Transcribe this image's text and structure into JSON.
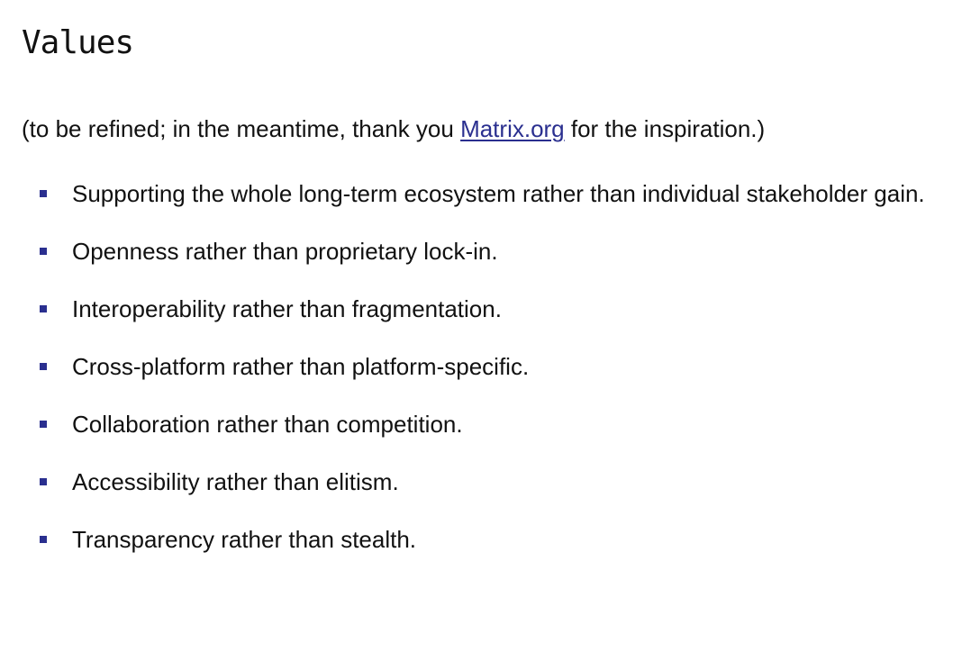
{
  "heading": "Values",
  "intro": {
    "before": "(to be refined; in the meantime, thank you ",
    "link": "Matrix.org",
    "after": " for the inspiration.)"
  },
  "colors": {
    "accent": "#2a2f8f",
    "text": "#111111"
  },
  "values": [
    "Supporting the whole long-term ecosystem rather than individual stakeholder gain.",
    "Openness rather than proprietary lock-in.",
    "Interoperability rather than fragmentation.",
    "Cross-platform rather than platform-specific.",
    "Collaboration rather than competition.",
    "Accessibility rather than elitism.",
    "Transparency rather than stealth."
  ]
}
